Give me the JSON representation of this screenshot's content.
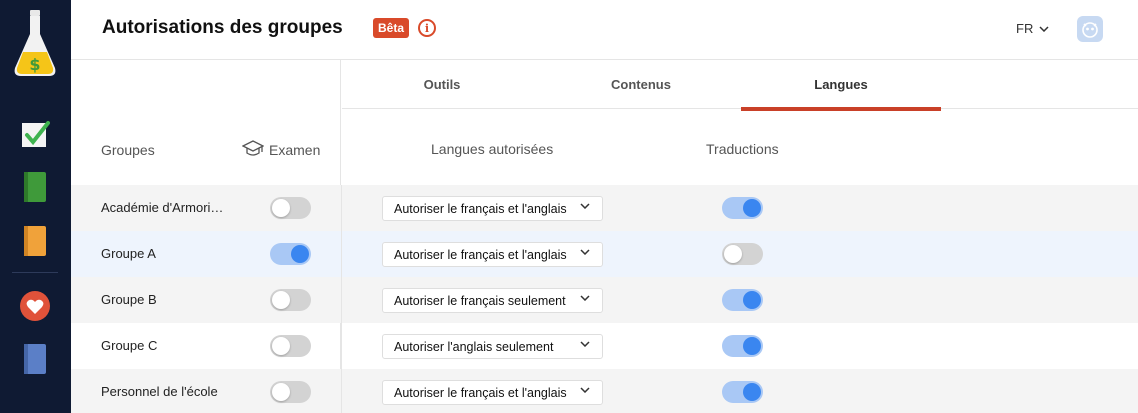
{
  "header": {
    "title": "Autorisations des groupes",
    "badge": "Bêta",
    "info_glyph": "i",
    "language": "FR"
  },
  "tabs": [
    {
      "label": "Outils",
      "active": false
    },
    {
      "label": "Contenus",
      "active": false
    },
    {
      "label": "Langues",
      "active": true
    }
  ],
  "columns": {
    "groups": "Groupes",
    "exam": "Examen",
    "allowed_languages": "Langues autorisées",
    "translations": "Traductions"
  },
  "rows": [
    {
      "name": "Académie d'Armorique",
      "exam": false,
      "language_option": "Autoriser le français et l'anglais",
      "translations": true
    },
    {
      "name": "Groupe A",
      "exam": true,
      "language_option": "Autoriser le français et l'anglais",
      "translations": false
    },
    {
      "name": "Groupe B",
      "exam": false,
      "language_option": "Autoriser le français seulement",
      "translations": true
    },
    {
      "name": "Groupe C",
      "exam": false,
      "language_option": "Autoriser l'anglais seulement",
      "translations": true
    },
    {
      "name": "Personnel de l'école",
      "exam": false,
      "language_option": "Autoriser le français et l'anglais",
      "translations": true
    }
  ],
  "sidebar": {
    "items": [
      {
        "icon": "flask-logo-icon"
      },
      {
        "icon": "checkmark-icon"
      },
      {
        "icon": "green-book-icon"
      },
      {
        "icon": "orange-book-icon"
      },
      {
        "icon": "heart-icon"
      },
      {
        "icon": "blue-book-icon"
      }
    ]
  },
  "colors": {
    "sidebar_bg": "#0f1a33",
    "accent": "#c94028",
    "toggle_on": "#3a86f0",
    "toggle_on_track": "#a9c8f5",
    "toggle_off_track": "#d3d3d3"
  }
}
